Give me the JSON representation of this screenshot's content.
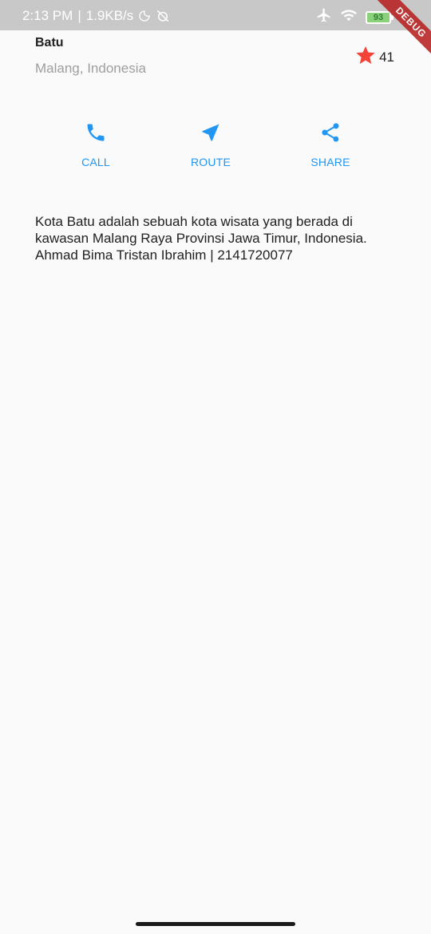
{
  "status_bar": {
    "time": "2:13 PM",
    "separator": "|",
    "net_speed": "1.9KB/s",
    "battery_level": "93",
    "icons": [
      "moon-icon",
      "alarm-off-icon",
      "airplane-icon",
      "wifi-icon",
      "battery-icon",
      "charging-icon"
    ]
  },
  "debug_banner": {
    "label": "DEBUG"
  },
  "place": {
    "name": "Batu",
    "location": "Malang, Indonesia",
    "rating": "41",
    "rating_icon": "star-icon",
    "rating_color": "#f44336"
  },
  "actions": {
    "accent_color": "#2196f3",
    "call": {
      "label": "CALL",
      "icon": "phone-icon"
    },
    "route": {
      "label": "ROUTE",
      "icon": "navigation-icon"
    },
    "share": {
      "label": "SHARE",
      "icon": "share-icon"
    }
  },
  "description": {
    "text": "Kota Batu adalah sebuah kota wisata yang berada di kawasan Malang Raya Provinsi Jawa Timur, Indonesia. Ahmad Bima Tristan Ibrahim | 2141720077"
  }
}
